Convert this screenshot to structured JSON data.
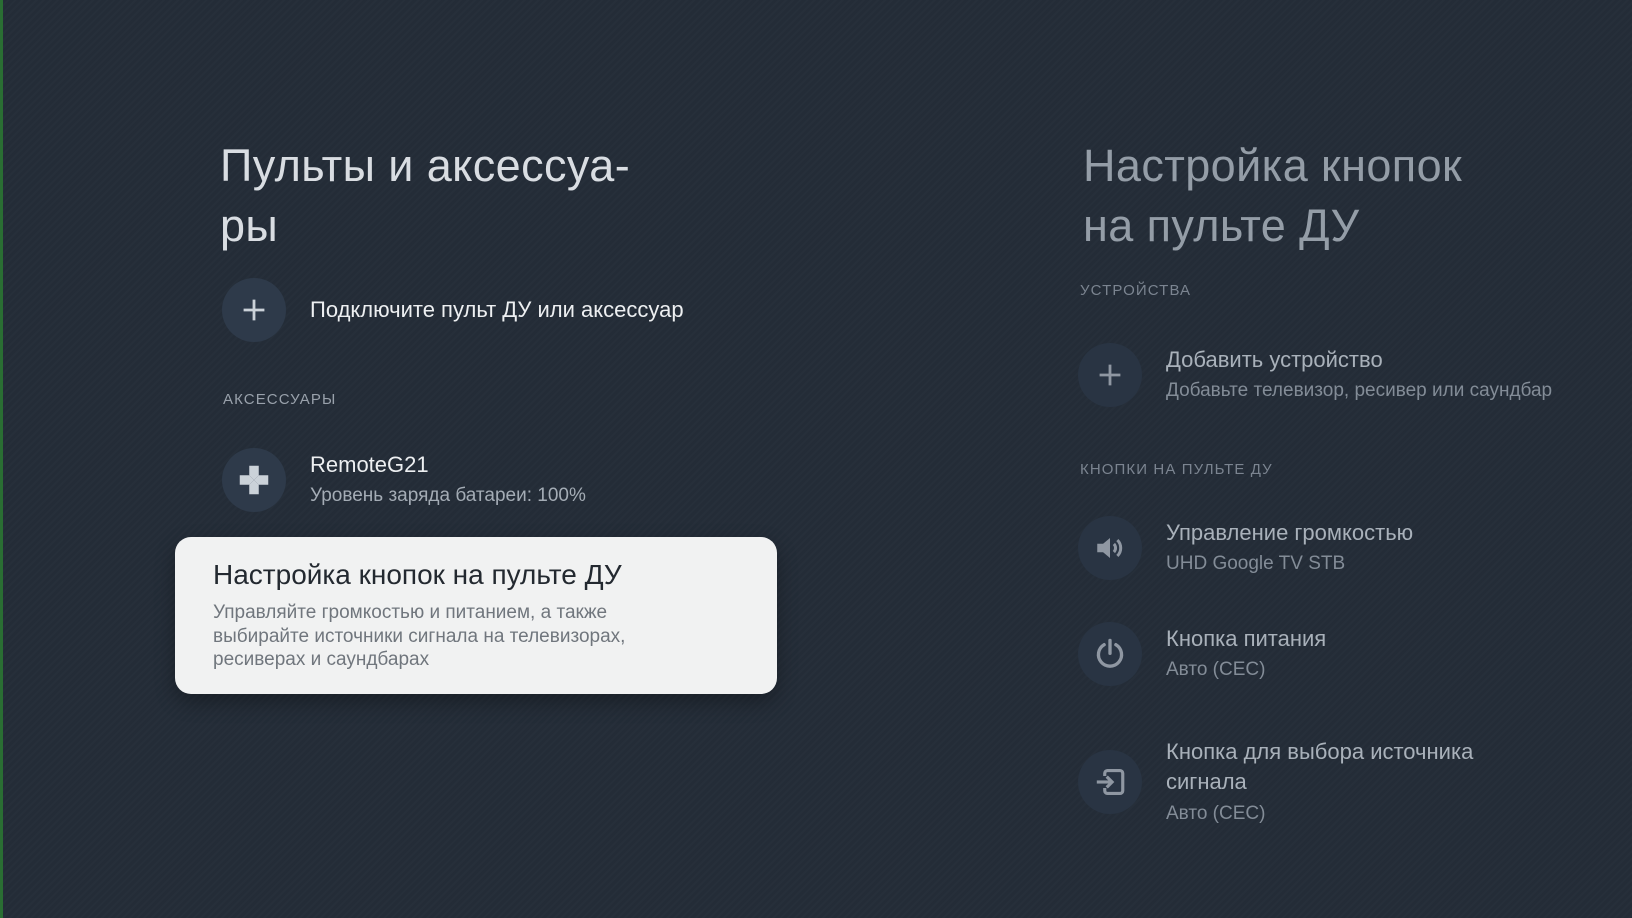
{
  "colors": {
    "background": "#242d38",
    "left_edge_accent": "#2a6e33",
    "icon_circle_left": "#2e3a4a",
    "icon_circle_right": "#293443",
    "card_background": "#f1f2f2",
    "primary_text": "#edeff1",
    "secondary_text": "#a4acb5",
    "dim_title": "#949da7"
  },
  "left_panel": {
    "title_lines": [
      "Пульты и аксессуа-",
      "ры"
    ],
    "connect_item": {
      "icon": "plus-icon",
      "label": "Подключите пульт ДУ или аксессуар"
    },
    "section_header": "АКСЕССУАРЫ",
    "accessory": {
      "icon": "gamepad-icon",
      "name": "RemoteG21",
      "battery": "Уровень заряда батареи: 100%"
    },
    "selected_card": {
      "title": "Настройка кнопок на пульте ДУ",
      "description_lines": [
        "Управляйте громкостью и питанием, а также",
        "выбирайте источники сигнала на телевизорах,",
        "ресиверах и саундбарах"
      ]
    }
  },
  "right_panel": {
    "title_lines": [
      "Настройка кнопок",
      "на пульте ДУ"
    ],
    "devices_header": "УСТРОЙСТВА",
    "add_device": {
      "icon": "plus-icon",
      "title": "Добавить устройство",
      "subtitle": "Добавьте телевизор, ресивер или саундбар"
    },
    "buttons_header": "КНОПКИ НА ПУЛЬТЕ ДУ",
    "items": [
      {
        "icon": "volume-icon",
        "title": "Управление громкостью",
        "subtitle": "UHD Google TV STB"
      },
      {
        "icon": "power-icon",
        "title": "Кнопка питания",
        "subtitle": "Авто (CEC)"
      },
      {
        "icon": "input-icon",
        "title_lines": [
          "Кнопка для выбора источника",
          "сигнала"
        ],
        "subtitle": "Авто (CEC)"
      }
    ]
  }
}
